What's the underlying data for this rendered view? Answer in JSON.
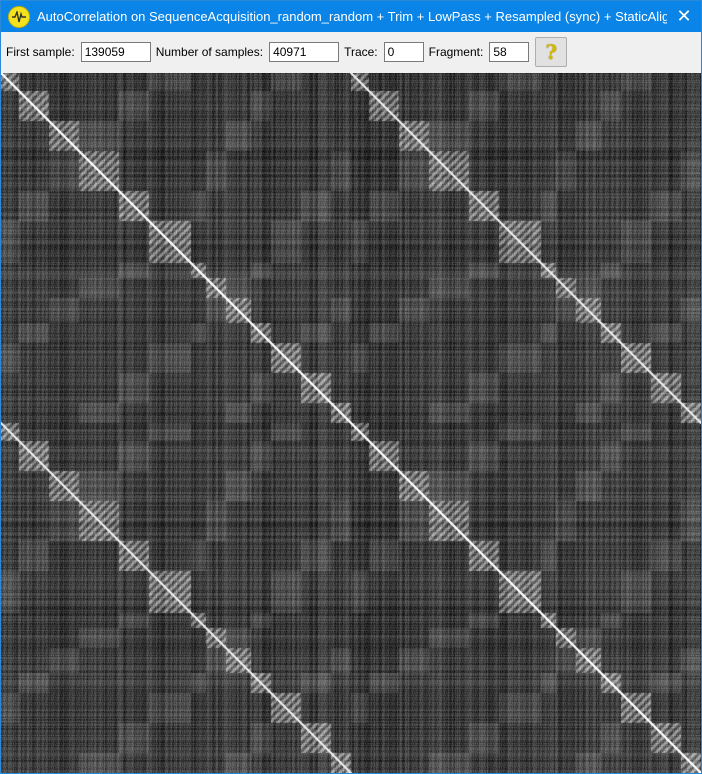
{
  "window": {
    "title": "AutoCorrelation on SequenceAcquisition_random_random + Trim + LowPass + Resampled (sync)  + StaticAlign + Trim ...",
    "close_glyph": "✕",
    "icon": "waveform-icon"
  },
  "toolbar": {
    "first_sample_label": "First sample:",
    "first_sample_value": "139059",
    "num_samples_label": "Number of samples:",
    "num_samples_value": "40971",
    "trace_label": "Trace:",
    "trace_value": "0",
    "fragment_label": "Fragment:",
    "fragment_value": "58",
    "help_glyph": "?",
    "help_icon": "question-mark-icon"
  },
  "heatmap": {
    "kind": "autocorrelation matrix",
    "colors": {
      "low": "#000000",
      "high": "#ffffff",
      "background": "#404040"
    },
    "title_bar_color": "#0a84e6"
  }
}
